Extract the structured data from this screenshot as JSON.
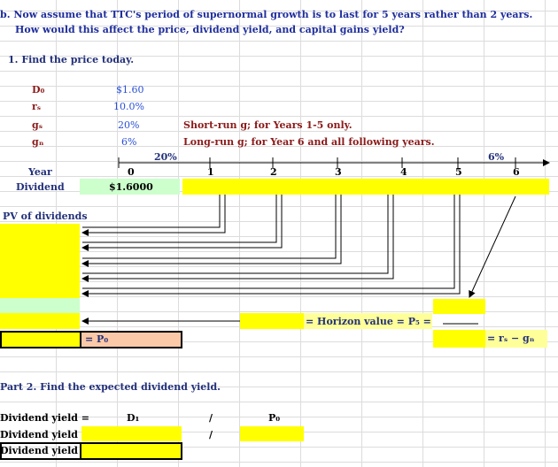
{
  "problem": {
    "line1": "b.  Now assume that TTC's period of supernormal growth is to last for 5 years rather than 2 years.",
    "line2": "How would this affect the price, dividend yield, and capital gains yield?"
  },
  "part1_title": "1. Find the price today.",
  "inputs": [
    {
      "label": "D₀",
      "value": "$1.60"
    },
    {
      "label": "rₛ",
      "value": "10.0%"
    },
    {
      "label": "gₛ",
      "value": "20%",
      "note": "Short-run g; for Years 1-5 only."
    },
    {
      "label": "gₙ",
      "value": "6%",
      "note": "Long-run g; for Year 6 and all following years."
    }
  ],
  "timeline": {
    "short_rate": "20%",
    "long_rate": "6%",
    "years": [
      "0",
      "1",
      "2",
      "3",
      "4",
      "5",
      "6"
    ],
    "year_label": "Year",
    "dividend_label": "Dividend",
    "d0": "$1.6000"
  },
  "pv_label": "PV of dividends",
  "horizon_label": "= Horizon value = P₅ =",
  "p0_label": "= P₀",
  "rs_minus_gn": "= rₛ − gₙ",
  "part2_title": "Part 2. Find the expected dividend yield.",
  "part2": {
    "rows": [
      "Dividend yield =",
      "Dividend yield =",
      "Dividend yield ="
    ],
    "d1": "D₁",
    "slash": "/",
    "p0": "P₀"
  },
  "colors": {
    "yellow": "#ffff00",
    "light_green": "#ccffcc",
    "peach": "#fbc8a8",
    "light_yellow": "#ffff99",
    "title_blue": "#1f2e9c",
    "note_red": "#8b1a1a",
    "value_blue": "#2a4fd6"
  }
}
